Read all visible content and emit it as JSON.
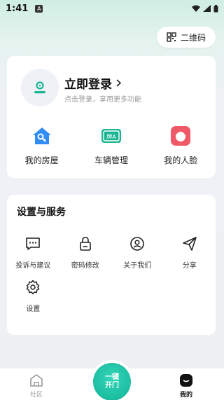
{
  "status_bar": {
    "time": "1:41",
    "a_badge": "A",
    "wifi_icon": "wifi-icon",
    "signal_icon": "signal-icon",
    "battery_icon": "battery-icon"
  },
  "qr": {
    "label": "二维码",
    "icon": "qr-code-icon"
  },
  "login": {
    "title": "立即登录",
    "subtitle": "点击登录，享用更多功能",
    "avatar_icon": "user-avatar-icon"
  },
  "quick": [
    {
      "label": "我的房屋",
      "icon": "house-key-icon",
      "color": "#2f8df5"
    },
    {
      "label": "车辆管理",
      "icon": "license-plate-icon",
      "color": "#1cb592"
    },
    {
      "label": "我的人脸",
      "icon": "face-icon",
      "color": "#f05a68"
    }
  ],
  "settings": {
    "title": "设置与服务",
    "items": [
      {
        "label": "投诉与建议",
        "icon": "message-icon"
      },
      {
        "label": "密码修改",
        "icon": "lock-icon"
      },
      {
        "label": "关于我们",
        "icon": "about-icon"
      },
      {
        "label": "分享",
        "icon": "share-icon"
      },
      {
        "label": "设置",
        "icon": "gear-icon"
      }
    ]
  },
  "tabbar": {
    "community": "社区",
    "open_door_line1": "一键",
    "open_door_line2": "开门",
    "mine": "我的"
  },
  "colors": {
    "accent": "#1cb592",
    "text": "#222222",
    "muted": "#999999"
  }
}
